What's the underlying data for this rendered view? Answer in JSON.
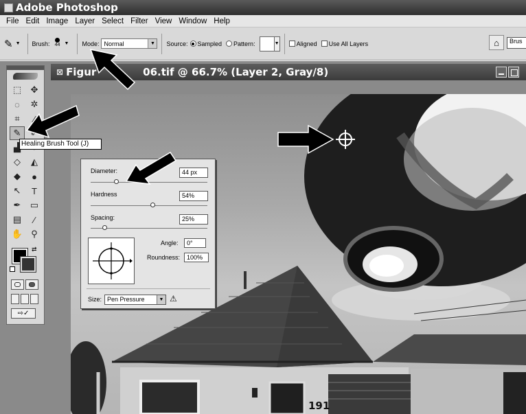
{
  "app": {
    "title": "Adobe Photoshop"
  },
  "menu": [
    "File",
    "Edit",
    "Image",
    "Layer",
    "Select",
    "Filter",
    "View",
    "Window",
    "Help"
  ],
  "options": {
    "brush_label": "Brush:",
    "brush_size": "44",
    "mode_label": "Mode:",
    "mode_value": "Normal",
    "source_label": "Source:",
    "sampled_label": "Sampled",
    "pattern_label": "Pattern:",
    "aligned_label": "Aligned",
    "use_all_layers_label": "Use All Layers",
    "brushes_tab": "Brus"
  },
  "document": {
    "title": "Figur             06.tif @ 66.7% (Layer 2, Gray/8)"
  },
  "tooltip": "Healing Brush Tool (J)",
  "brush_popup": {
    "diameter_label": "Diameter:",
    "diameter_value": "44 px",
    "hardness_label": "Hardness",
    "hardness_value": "54%",
    "spacing_label": "Spacing:",
    "spacing_value": "25%",
    "angle_label": "Angle:",
    "angle_value": "0°",
    "roundness_label": "Roundness:",
    "roundness_value": "100%",
    "size_label": "Size:",
    "size_value": "Pen Pressure"
  },
  "house": {
    "number": "191"
  },
  "colors": {
    "titlebar": "#3b3b3b",
    "canvas_sky": "#a9a9a9",
    "arrow": "#000000"
  }
}
